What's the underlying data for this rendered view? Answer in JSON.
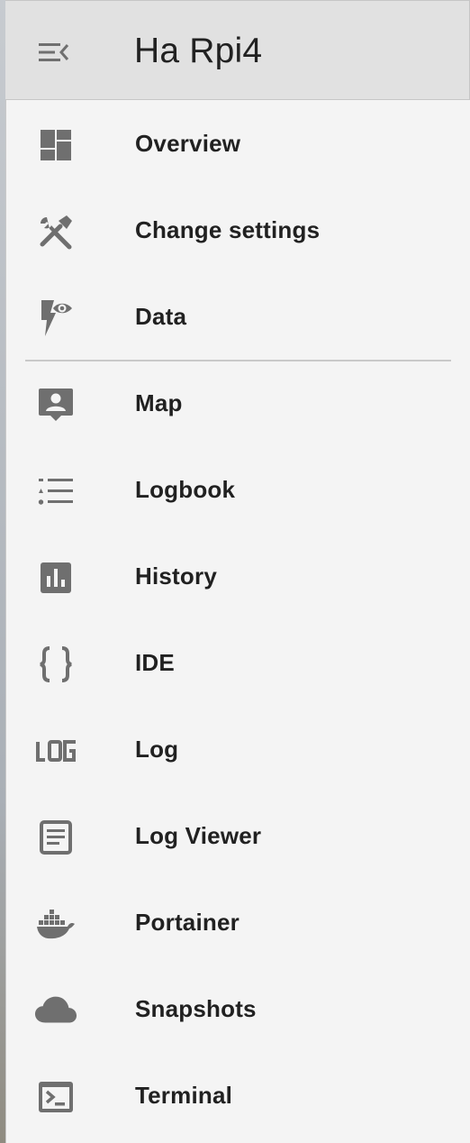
{
  "header": {
    "title": "Ha Rpi4",
    "menu_icon": "menu-open-icon"
  },
  "nav": {
    "primary": [
      {
        "label": "Overview",
        "icon": "dashboard-icon"
      },
      {
        "label": "Change settings",
        "icon": "tools-icon"
      },
      {
        "label": "Data",
        "icon": "flash-eye-icon"
      }
    ],
    "secondary": [
      {
        "label": "Map",
        "icon": "map-account-icon"
      },
      {
        "label": "Logbook",
        "icon": "logbook-list-icon"
      },
      {
        "label": "History",
        "icon": "chart-box-icon"
      },
      {
        "label": "IDE",
        "icon": "code-braces-icon"
      },
      {
        "label": "Log",
        "icon": "log-text-icon",
        "icon_text": "LOG"
      },
      {
        "label": "Log Viewer",
        "icon": "text-box-icon"
      },
      {
        "label": "Portainer",
        "icon": "docker-icon"
      },
      {
        "label": "Snapshots",
        "icon": "cloud-icon"
      },
      {
        "label": "Terminal",
        "icon": "console-icon"
      }
    ]
  },
  "colors": {
    "icon": "#6f6f6f",
    "text": "#212121",
    "header_bg": "#e1e1e1",
    "drawer_bg": "#f4f4f4"
  }
}
